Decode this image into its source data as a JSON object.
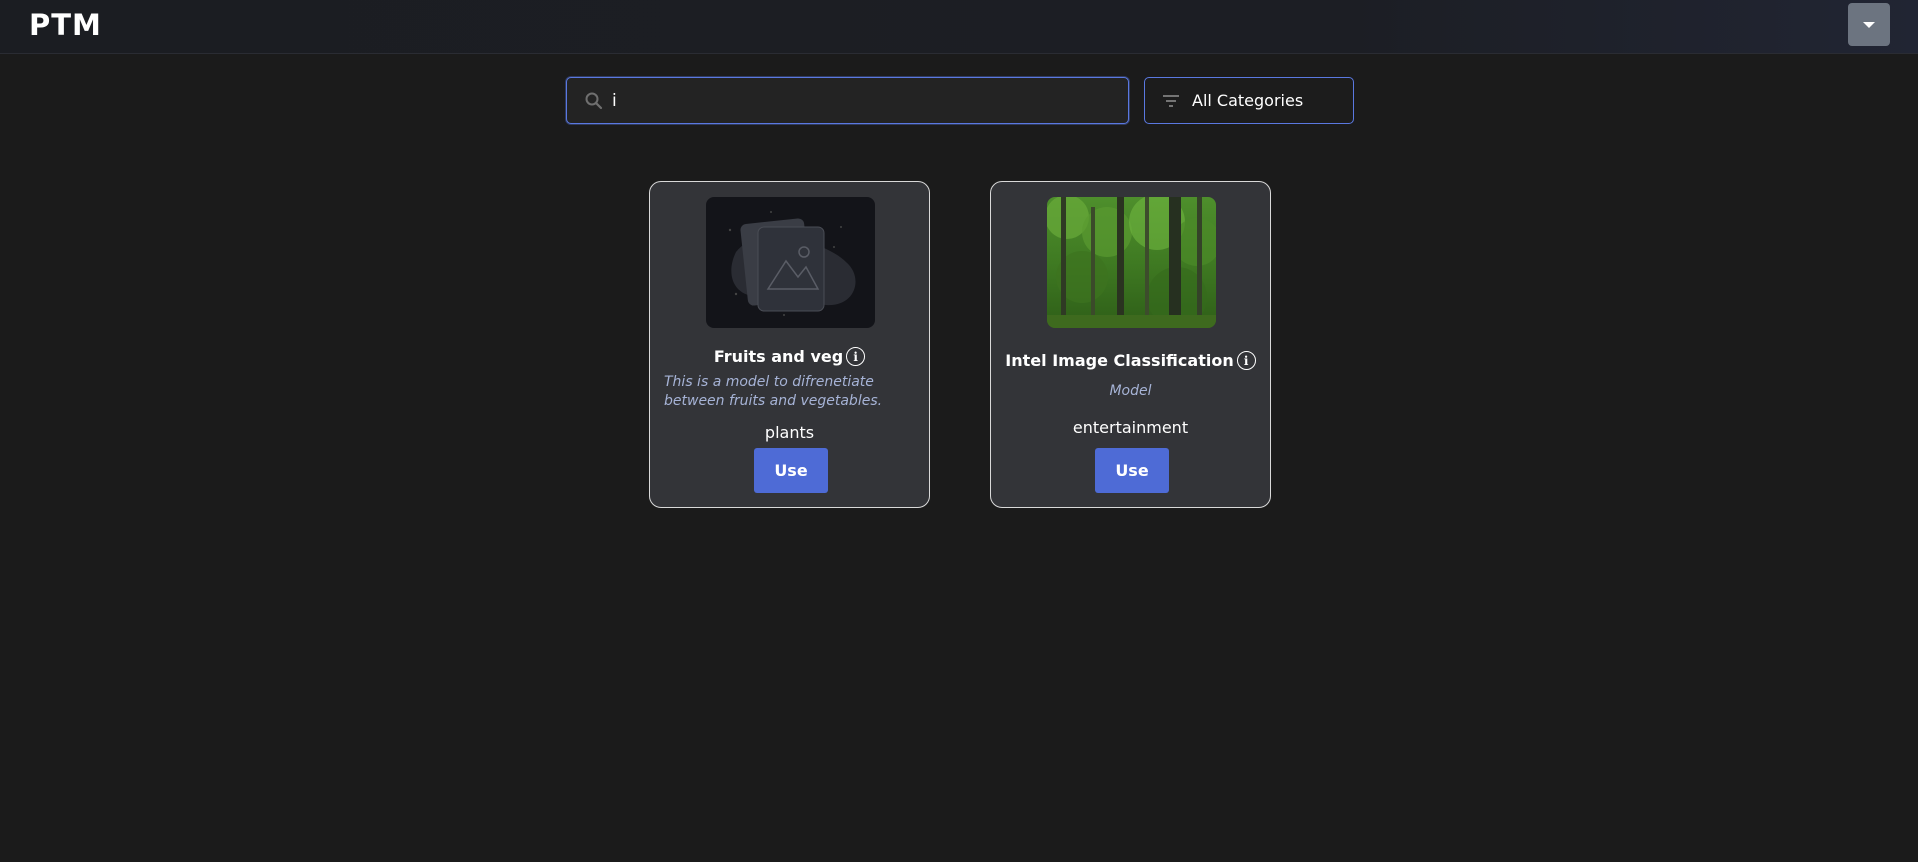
{
  "header": {
    "logo": "PTM",
    "menu_icon": "caret-down-icon"
  },
  "search": {
    "value": "i",
    "placeholder": "",
    "icon": "search-icon"
  },
  "filter": {
    "icon": "filter-icon",
    "selected": "All Categories"
  },
  "cards": [
    {
      "title": "Fruits and veg",
      "description": "This is a model to difrenetiate between fruits and vegetables.",
      "category": "plants",
      "button_label": "Use",
      "image": "placeholder-image"
    },
    {
      "title": "Intel Image Classification",
      "description": "Model",
      "category": "entertainment",
      "button_label": "Use",
      "image": "forest-photo"
    }
  ],
  "colors": {
    "accent": "#4e6bd6",
    "focus_border": "#5a78e0",
    "card_bg": "#333438",
    "page_bg": "#1b1b1b",
    "desc_text": "#a6b3d6"
  }
}
